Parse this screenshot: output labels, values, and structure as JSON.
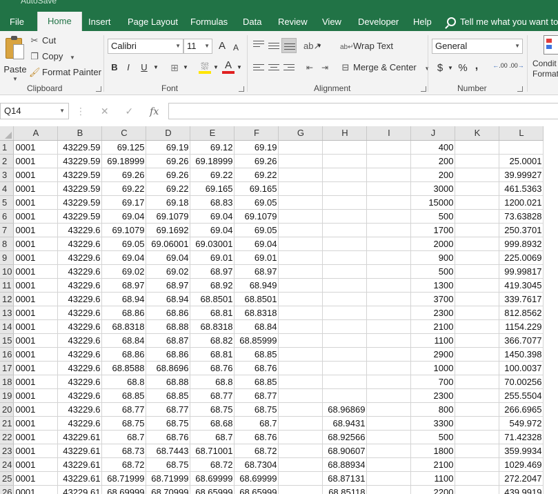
{
  "app": {
    "title_fragment": "AutoSave",
    "accent": "#217346"
  },
  "tabs": [
    {
      "label": "File"
    },
    {
      "label": "Home"
    },
    {
      "label": "Insert"
    },
    {
      "label": "Page Layout"
    },
    {
      "label": "Formulas"
    },
    {
      "label": "Data"
    },
    {
      "label": "Review"
    },
    {
      "label": "View"
    },
    {
      "label": "Developer"
    },
    {
      "label": "Help"
    }
  ],
  "tell_me": "Tell me what you want to",
  "ribbon": {
    "clipboard": {
      "paste": "Paste",
      "cut": "Cut",
      "copy": "Copy",
      "format_painter": "Format Painter",
      "label": "Clipboard"
    },
    "font": {
      "family": "Calibri",
      "size": "11",
      "bold": "B",
      "italic": "I",
      "underline": "U",
      "grow": "A",
      "shrink": "A",
      "label": "Font"
    },
    "alignment": {
      "wrap_text": "Wrap Text",
      "merge_center": "Merge & Center",
      "label": "Alignment"
    },
    "number": {
      "format": "General",
      "currency": "$",
      "percent": "%",
      "comma": ",",
      "inc_decimal": ".00",
      "dec_decimal": ".00",
      "label": "Number"
    },
    "styles": {
      "conditional_formatting": "Conditional Formatting",
      "conditional_line1": "Condit",
      "conditional_line2": "Formatt"
    }
  },
  "formula_bar": {
    "name_box": "Q14",
    "fx": "fx",
    "value": ""
  },
  "columns": [
    "A",
    "B",
    "C",
    "D",
    "E",
    "F",
    "G",
    "H",
    "I",
    "J",
    "K",
    "L"
  ],
  "rows": [
    {
      "n": "1",
      "A": "0001",
      "B": "43229.59",
      "C": "69.125",
      "D": "69.19",
      "E": "69.12",
      "F": "69.19",
      "H": "",
      "J": "400",
      "L": ""
    },
    {
      "n": "2",
      "A": "0001",
      "B": "43229.59",
      "C": "69.18999",
      "D": "69.26",
      "E": "69.18999",
      "F": "69.26",
      "H": "",
      "J": "200",
      "L": "25.0001"
    },
    {
      "n": "3",
      "A": "0001",
      "B": "43229.59",
      "C": "69.26",
      "D": "69.26",
      "E": "69.22",
      "F": "69.22",
      "H": "",
      "J": "200",
      "L": "39.99927"
    },
    {
      "n": "4",
      "A": "0001",
      "B": "43229.59",
      "C": "69.22",
      "D": "69.22",
      "E": "69.165",
      "F": "69.165",
      "H": "",
      "J": "3000",
      "L": "461.5363"
    },
    {
      "n": "5",
      "A": "0001",
      "B": "43229.59",
      "C": "69.17",
      "D": "69.18",
      "E": "68.83",
      "F": "69.05",
      "H": "",
      "J": "15000",
      "L": "1200.021"
    },
    {
      "n": "6",
      "A": "0001",
      "B": "43229.59",
      "C": "69.04",
      "D": "69.1079",
      "E": "69.04",
      "F": "69.1079",
      "H": "",
      "J": "500",
      "L": "73.63828"
    },
    {
      "n": "7",
      "A": "0001",
      "B": "43229.6",
      "C": "69.1079",
      "D": "69.1692",
      "E": "69.04",
      "F": "69.05",
      "H": "",
      "J": "1700",
      "L": "250.3701"
    },
    {
      "n": "8",
      "A": "0001",
      "B": "43229.6",
      "C": "69.05",
      "D": "69.06001",
      "E": "69.03001",
      "F": "69.04",
      "H": "",
      "J": "2000",
      "L": "999.8932"
    },
    {
      "n": "9",
      "A": "0001",
      "B": "43229.6",
      "C": "69.04",
      "D": "69.04",
      "E": "69.01",
      "F": "69.01",
      "H": "",
      "J": "900",
      "L": "225.0069"
    },
    {
      "n": "10",
      "A": "0001",
      "B": "43229.6",
      "C": "69.02",
      "D": "69.02",
      "E": "68.97",
      "F": "68.97",
      "H": "",
      "J": "500",
      "L": "99.99817"
    },
    {
      "n": "11",
      "A": "0001",
      "B": "43229.6",
      "C": "68.97",
      "D": "68.97",
      "E": "68.92",
      "F": "68.949",
      "H": "",
      "J": "1300",
      "L": "419.3045"
    },
    {
      "n": "12",
      "A": "0001",
      "B": "43229.6",
      "C": "68.94",
      "D": "68.94",
      "E": "68.8501",
      "F": "68.8501",
      "H": "",
      "J": "3700",
      "L": "339.7617"
    },
    {
      "n": "13",
      "A": "0001",
      "B": "43229.6",
      "C": "68.86",
      "D": "68.86",
      "E": "68.81",
      "F": "68.8318",
      "H": "",
      "J": "2300",
      "L": "812.8562"
    },
    {
      "n": "14",
      "A": "0001",
      "B": "43229.6",
      "C": "68.8318",
      "D": "68.88",
      "E": "68.8318",
      "F": "68.84",
      "H": "",
      "J": "2100",
      "L": "1154.229"
    },
    {
      "n": "15",
      "A": "0001",
      "B": "43229.6",
      "C": "68.84",
      "D": "68.87",
      "E": "68.82",
      "F": "68.85999",
      "H": "",
      "J": "1100",
      "L": "366.7077"
    },
    {
      "n": "16",
      "A": "0001",
      "B": "43229.6",
      "C": "68.86",
      "D": "68.86",
      "E": "68.81",
      "F": "68.85",
      "H": "",
      "J": "2900",
      "L": "1450.398"
    },
    {
      "n": "17",
      "A": "0001",
      "B": "43229.6",
      "C": "68.8588",
      "D": "68.8696",
      "E": "68.76",
      "F": "68.76",
      "H": "",
      "J": "1000",
      "L": "100.0037"
    },
    {
      "n": "18",
      "A": "0001",
      "B": "43229.6",
      "C": "68.8",
      "D": "68.88",
      "E": "68.8",
      "F": "68.85",
      "H": "",
      "J": "700",
      "L": "70.00256"
    },
    {
      "n": "19",
      "A": "0001",
      "B": "43229.6",
      "C": "68.85",
      "D": "68.85",
      "E": "68.77",
      "F": "68.77",
      "H": "",
      "J": "2300",
      "L": "255.5504"
    },
    {
      "n": "20",
      "A": "0001",
      "B": "43229.6",
      "C": "68.77",
      "D": "68.77",
      "E": "68.75",
      "F": "68.75",
      "H": "68.96869",
      "J": "800",
      "L": "266.6965"
    },
    {
      "n": "21",
      "A": "0001",
      "B": "43229.6",
      "C": "68.75",
      "D": "68.75",
      "E": "68.68",
      "F": "68.7",
      "H": "68.9431",
      "J": "3300",
      "L": "549.972"
    },
    {
      "n": "22",
      "A": "0001",
      "B": "43229.61",
      "C": "68.7",
      "D": "68.76",
      "E": "68.7",
      "F": "68.76",
      "H": "68.92566",
      "J": "500",
      "L": "71.42328"
    },
    {
      "n": "23",
      "A": "0001",
      "B": "43229.61",
      "C": "68.73",
      "D": "68.7443",
      "E": "68.71001",
      "F": "68.72",
      "H": "68.90607",
      "J": "1800",
      "L": "359.9934"
    },
    {
      "n": "24",
      "A": "0001",
      "B": "43229.61",
      "C": "68.72",
      "D": "68.75",
      "E": "68.72",
      "F": "68.7304",
      "H": "68.88934",
      "J": "2100",
      "L": "1029.469"
    },
    {
      "n": "25",
      "A": "0001",
      "B": "43229.61",
      "C": "68.71999",
      "D": "68.71999",
      "E": "68.69999",
      "F": "68.69999",
      "H": "68.87131",
      "J": "1100",
      "L": "272.2047"
    },
    {
      "n": "26",
      "A": "0001",
      "B": "43229.61",
      "C": "68.69999",
      "D": "68.70999",
      "E": "68.65999",
      "F": "68.65999",
      "H": "68.85118",
      "J": "2200",
      "L": "439.9919"
    }
  ]
}
